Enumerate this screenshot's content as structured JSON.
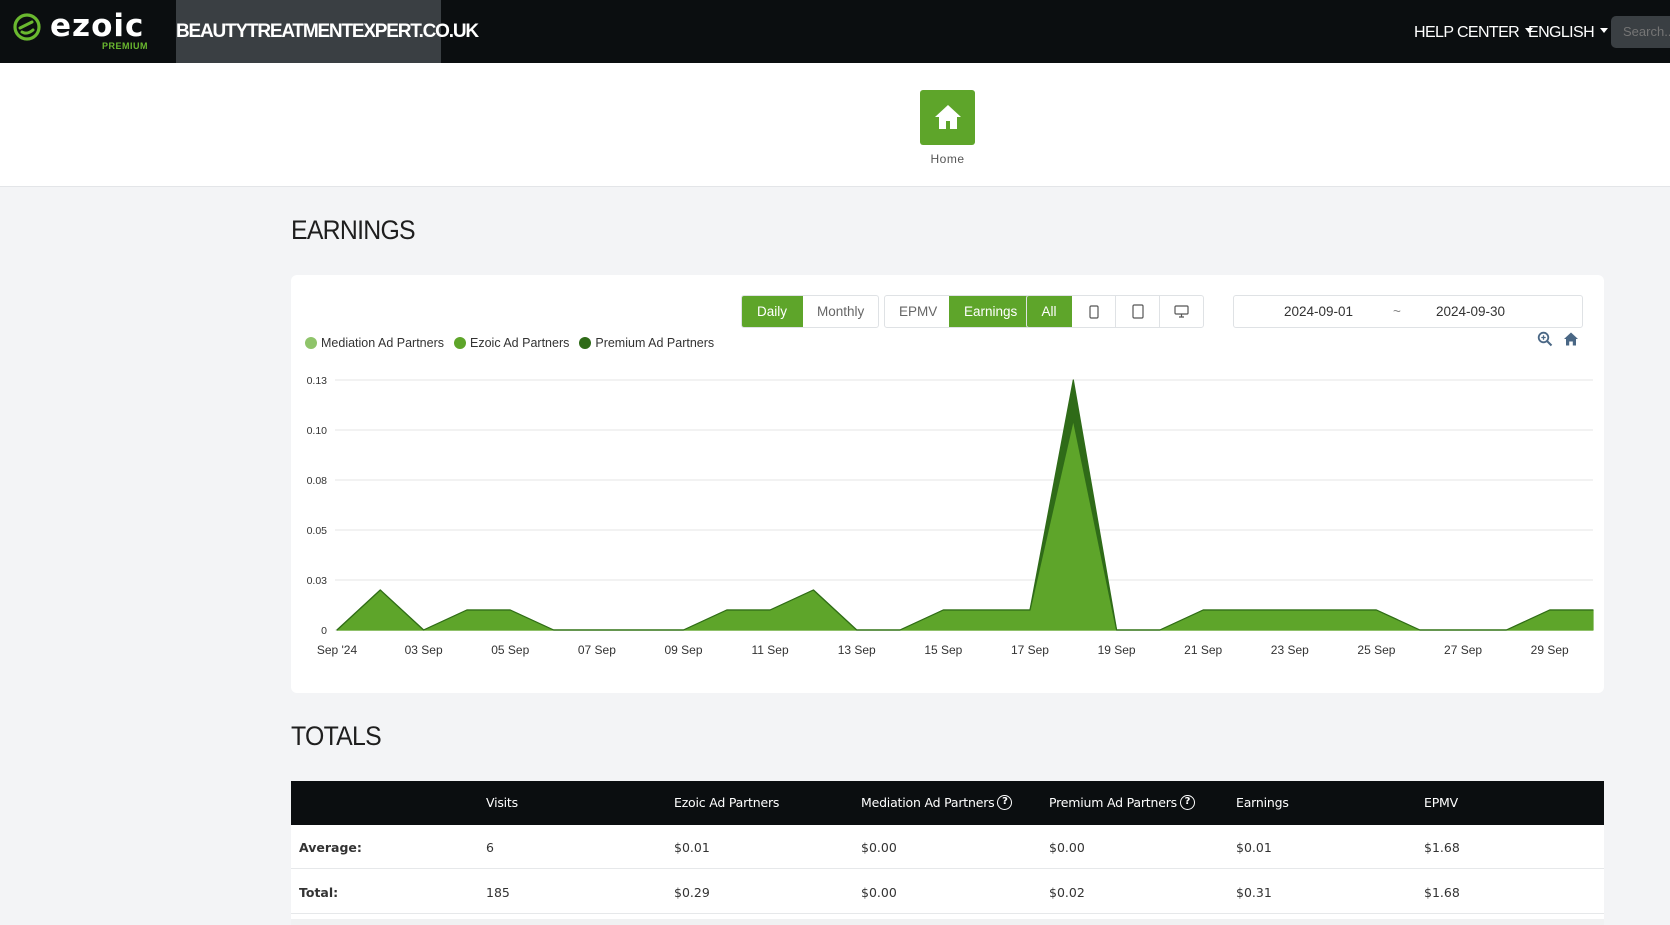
{
  "header": {
    "logo_text": "ezoic",
    "logo_sub": "PREMIUM",
    "site_name": "BEAUTYTREATMENTEXPERT.CO.UK",
    "help_center_label": "HELP CENTER",
    "language_label": "ENGLISH",
    "search_placeholder": "Search..."
  },
  "home": {
    "label": "Home"
  },
  "earnings": {
    "title": "EARNINGS",
    "period_buttons": [
      {
        "label": "Daily",
        "active": true
      },
      {
        "label": "Monthly",
        "active": false
      }
    ],
    "metric_buttons": [
      {
        "label": "EPMV",
        "active": false
      },
      {
        "label": "Earnings",
        "active": true
      }
    ],
    "device_buttons": [
      {
        "label": "All",
        "active": true
      },
      {
        "icon": "mobile-icon"
      },
      {
        "icon": "tablet-icon"
      },
      {
        "icon": "desktop-icon"
      }
    ],
    "date_start": "2024-09-01",
    "date_sep": "~",
    "date_end": "2024-09-30",
    "tools": [
      "zoom-icon",
      "reset-home-icon"
    ]
  },
  "chart_data": {
    "type": "area",
    "stacked": true,
    "grid": true,
    "legend_position": "top-left",
    "x": [
      "2024-09-01",
      "2024-09-02",
      "2024-09-03",
      "2024-09-04",
      "2024-09-05",
      "2024-09-06",
      "2024-09-07",
      "2024-09-08",
      "2024-09-09",
      "2024-09-10",
      "2024-09-11",
      "2024-09-12",
      "2024-09-13",
      "2024-09-14",
      "2024-09-15",
      "2024-09-16",
      "2024-09-17",
      "2024-09-18",
      "2024-09-19",
      "2024-09-20",
      "2024-09-21",
      "2024-09-22",
      "2024-09-23",
      "2024-09-24",
      "2024-09-25",
      "2024-09-26",
      "2024-09-27",
      "2024-09-28",
      "2024-09-29",
      "2024-09-30"
    ],
    "x_tick_labels": [
      "Sep '24",
      "03 Sep",
      "05 Sep",
      "07 Sep",
      "09 Sep",
      "11 Sep",
      "13 Sep",
      "15 Sep",
      "17 Sep",
      "19 Sep",
      "21 Sep",
      "23 Sep",
      "25 Sep",
      "27 Sep",
      "29 Sep"
    ],
    "y_tick_labels": [
      "0",
      "0.03",
      "0.05",
      "0.08",
      "0.10",
      "0.13"
    ],
    "ylim": [
      0,
      0.125
    ],
    "series": [
      {
        "name": "Mediation Ad Partners",
        "color": "#8fc46a",
        "values": [
          0,
          0,
          0,
          0,
          0,
          0,
          0,
          0,
          0,
          0,
          0,
          0,
          0,
          0,
          0,
          0,
          0,
          0,
          0,
          0,
          0,
          0,
          0,
          0,
          0,
          0,
          0,
          0,
          0,
          0
        ]
      },
      {
        "name": "Ezoic Ad Partners",
        "color": "#5ea52a",
        "values": [
          0,
          0.02,
          0,
          0.01,
          0.01,
          0,
          0,
          0,
          0,
          0.01,
          0.01,
          0.02,
          0,
          0,
          0.01,
          0.01,
          0.01,
          0.105,
          0,
          0,
          0.01,
          0.01,
          0.01,
          0.01,
          0.01,
          0,
          0,
          0,
          0.01,
          0.01
        ]
      },
      {
        "name": "Premium Ad Partners",
        "color": "#2f6b18",
        "values": [
          0,
          0,
          0,
          0,
          0,
          0,
          0,
          0,
          0,
          0,
          0,
          0,
          0,
          0,
          0,
          0,
          0,
          0.02,
          0,
          0,
          0,
          0,
          0,
          0,
          0,
          0,
          0,
          0,
          0,
          0
        ]
      }
    ]
  },
  "totals": {
    "title": "TOTALS",
    "columns": [
      "",
      "Visits",
      "Ezoic Ad Partners",
      "Mediation Ad Partners",
      "Premium Ad Partners",
      "Earnings",
      "EPMV"
    ],
    "rows": [
      {
        "label": "Average:",
        "cells": [
          "6",
          "$0.01",
          "$0.00",
          "$0.00",
          "$0.01",
          "$1.68"
        ]
      },
      {
        "label": "Total:",
        "cells": [
          "185",
          "$0.29",
          "$0.00",
          "$0.02",
          "$0.31",
          "$1.68"
        ]
      }
    ]
  },
  "colors": {
    "accent": "#5ea52a",
    "topbar": "#0b0e10",
    "site_tab": "#3a3f43"
  }
}
